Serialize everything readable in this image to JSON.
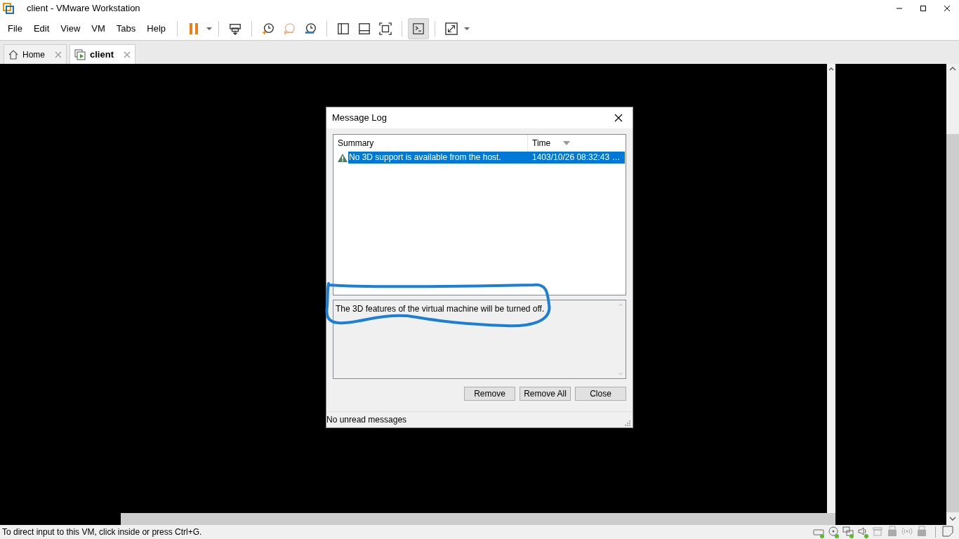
{
  "window": {
    "title": "client - VMware Workstation"
  },
  "menu": [
    "File",
    "Edit",
    "View",
    "VM",
    "Tabs",
    "Help"
  ],
  "toolbar": [
    {
      "kind": "pause",
      "pressed": false
    },
    {
      "kind": "send-keys",
      "pressed": false
    },
    {
      "kind": "snapshot",
      "pressed": false
    },
    {
      "kind": "revert",
      "pressed": false
    },
    {
      "kind": "snapshot-manager",
      "pressed": false
    },
    {
      "kind": "sidebar",
      "pressed": false
    },
    {
      "kind": "thumbnail",
      "pressed": false
    },
    {
      "kind": "fullscreen",
      "pressed": false
    },
    {
      "kind": "console",
      "pressed": true
    },
    {
      "kind": "stretch",
      "pressed": false
    }
  ],
  "tabs": [
    {
      "label": "Home",
      "selected": false,
      "kind": "home"
    },
    {
      "label": "client",
      "selected": true,
      "kind": "vm"
    }
  ],
  "dialog": {
    "title": "Message Log",
    "columns": [
      "Summary",
      "Time"
    ],
    "messages": [
      {
        "summary": "No 3D support is available from the host.",
        "time": "1403/10/26 08:32:43 …",
        "selected": true,
        "kind": "warning"
      }
    ],
    "detail": "The 3D features of the virtual machine will be turned off.",
    "buttons": [
      "Remove",
      "Remove All",
      "Close"
    ],
    "status": "No unread messages"
  },
  "status_bar": {
    "text": "To direct input to this VM, click inside or press Ctrl+G.",
    "devices": [
      {
        "kind": "hdd",
        "connected": true
      },
      {
        "kind": "cd",
        "connected": true
      },
      {
        "kind": "network",
        "connected": true
      },
      {
        "kind": "sound",
        "connected": true
      },
      {
        "kind": "printer",
        "connected": false
      },
      {
        "kind": "usb",
        "connected": false
      },
      {
        "kind": "wireless",
        "connected": false
      },
      {
        "kind": "usb",
        "connected": false
      },
      {
        "kind": "messages",
        "connected": false
      }
    ]
  }
}
